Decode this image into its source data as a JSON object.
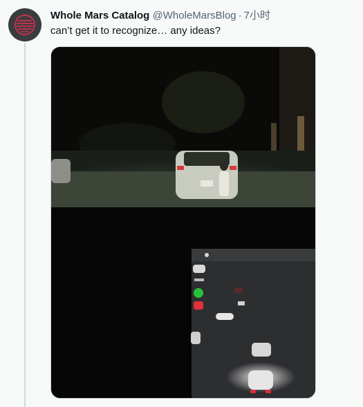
{
  "tweet": {
    "author_name": "Whole Mars Catalog",
    "author_handle": "@WholeMarsBlog",
    "separator": "·",
    "timestamp": "7小时",
    "text": "can’t get it to recognize… any ideas?"
  },
  "icons": {
    "avatar": "mars-logo-icon"
  },
  "colors": {
    "name_text": "#0f1419",
    "muted_text": "#536471",
    "page_background": "#f7f9f9",
    "thread_line": "#cfd9de",
    "avatar_background": "#3f4145",
    "avatar_accent": "#c2334a"
  }
}
